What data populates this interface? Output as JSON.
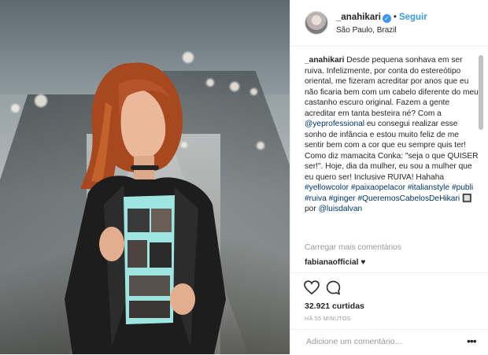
{
  "post": {
    "username": "_anahikari",
    "verified_icon": "verified-badge-icon",
    "separator": "•",
    "follow_label": "Seguir",
    "location": "São Paulo, Brazil",
    "caption": {
      "user": "_anahikari",
      "text_1": "Desde pequena sonhava em ser ruiva. Infelizmente, por conta do estereótipo oriental, me fizeram acreditar por anos que eu não ficaria bem com um cabelo diferente do meu castanho escuro original. Fazem a gente acreditar em tanta besteira né? Com a ",
      "mention_1": "@yeprofessional",
      "text_2": " eu consegui realizar esse sonho de infância e estou muito feliz de me sentir bem com a cor que eu sempre quis ter! Como diz mamacita Conka: \"seja o que QUISER ser!\". Hoje, dia da mulher, eu sou a mulher que eu quero ser! Inclusive RUIVA! Hahaha ",
      "hashtags": [
        "#yellowcolor",
        "#paixaopelacor",
        "#italianstyle",
        "#publi",
        "#ruiva",
        "#ginger",
        "#QueremosCabelosDeHikari"
      ],
      "text_3": " 🔲 por ",
      "mention_2": "@luisdalvan"
    },
    "load_more_comments": "Carregar mais comentários",
    "comment": {
      "user": "fabianaofficial",
      "text": "♥"
    },
    "likes": "32.921 curtidas",
    "time_ago": "HÁ 55 MINUTOS",
    "add_comment_placeholder": "Adicione um comentário...",
    "more_label": "•••"
  },
  "icons": {
    "like": "heart-outline-icon",
    "comment": "comment-bubble-icon",
    "more": "more-options-icon"
  },
  "colors": {
    "link": "#003569",
    "follow": "#3897f0",
    "muted": "#999999",
    "text": "#262626"
  }
}
